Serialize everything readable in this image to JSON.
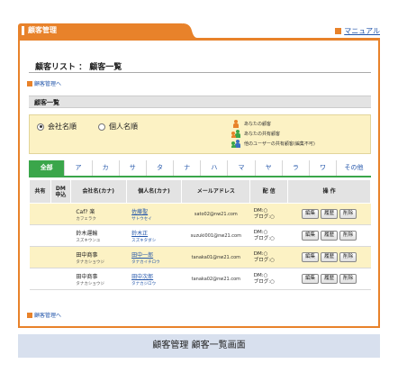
{
  "header": {
    "title": "顧客管理",
    "manual_label": "マニュアル"
  },
  "breadcrumb": {
    "title": "顧客リスト ： 顧客一覧",
    "back_label": "顧客管理へ"
  },
  "section": {
    "title": "顧客一覧"
  },
  "sort": {
    "options": [
      {
        "label": "会社名順",
        "selected": true
      },
      {
        "label": "個人名順",
        "selected": false
      }
    ]
  },
  "legend": [
    {
      "label": "あなたの顧客",
      "icon": "person-orange-icon"
    },
    {
      "label": "あなたの共有顧客",
      "icon": "persons-shared-icon"
    },
    {
      "label": "他のユーザーの共有顧客(編集不可)",
      "icon": "persons-other-icon"
    }
  ],
  "tabs": [
    "全部",
    "ア",
    "カ",
    "サ",
    "タ",
    "ナ",
    "ハ",
    "マ",
    "ヤ",
    "ラ",
    "ワ",
    "その他"
  ],
  "columns": {
    "share": "共有",
    "dm_line1": "DM",
    "dm_line2": "申込",
    "company": "会社名(カナ)",
    "person": "個人名(カナ)",
    "email": "メールアドレス",
    "delivery": "配 信",
    "ops": "操 作"
  },
  "rows": [
    {
      "company": "Caf? 楽",
      "company_kana": "カフェラク",
      "person": "佐藤聖",
      "person_kana": "サトウセイ",
      "email": "sato02@nw21.com",
      "dm": "DM:○",
      "blog": "ブログ:○"
    },
    {
      "company": "鈴木運輸",
      "company_kana": "スズキウンユ",
      "person": "鈴木正",
      "person_kana": "スズキタダシ",
      "email": "suzuki001@nw21.com",
      "dm": "DM:○",
      "blog": "ブログ:○"
    },
    {
      "company": "田中商事",
      "company_kana": "タナカショウジ",
      "person": "田中一郎",
      "person_kana": "タナカイチロウ",
      "email": "tanaka01@nw21.com",
      "dm": "DM:○",
      "blog": "ブログ:○"
    },
    {
      "company": "田中商事",
      "company_kana": "タナカショウジ",
      "person": "田中次郎",
      "person_kana": "タナカジロウ",
      "email": "tanaka02@nw21.com",
      "dm": "DM:○",
      "blog": "ブログ:○"
    }
  ],
  "row_buttons": {
    "edit": "編集",
    "history": "履歴",
    "delete": "削除"
  },
  "caption": "顧客管理 顧客一覧画面",
  "colors": {
    "accent": "#e8822a",
    "tab_active": "#3aa64a",
    "highlight": "#fcf2c4",
    "link": "#2255aa"
  }
}
